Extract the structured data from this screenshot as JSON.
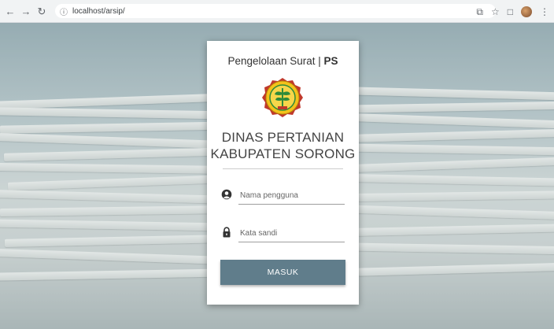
{
  "browser": {
    "url": "localhost/arsip/",
    "back_icon": "arrow-left-icon",
    "forward_icon": "arrow-right-icon",
    "reload_icon": "reload-icon"
  },
  "login": {
    "app_title": "Pengelolaan Surat | ",
    "app_title_bold": "PS",
    "org_line1": "DINAS PERTANIAN",
    "org_line2": "KABUPATEN SORONG",
    "username_placeholder": "Nama pengguna",
    "password_placeholder": "Kata sandi",
    "submit_label": "MASUK"
  },
  "colors": {
    "button": "#607d8b",
    "logo_yellow": "#f4c21a",
    "logo_red": "#c0392b",
    "logo_green": "#2e8b3a"
  }
}
